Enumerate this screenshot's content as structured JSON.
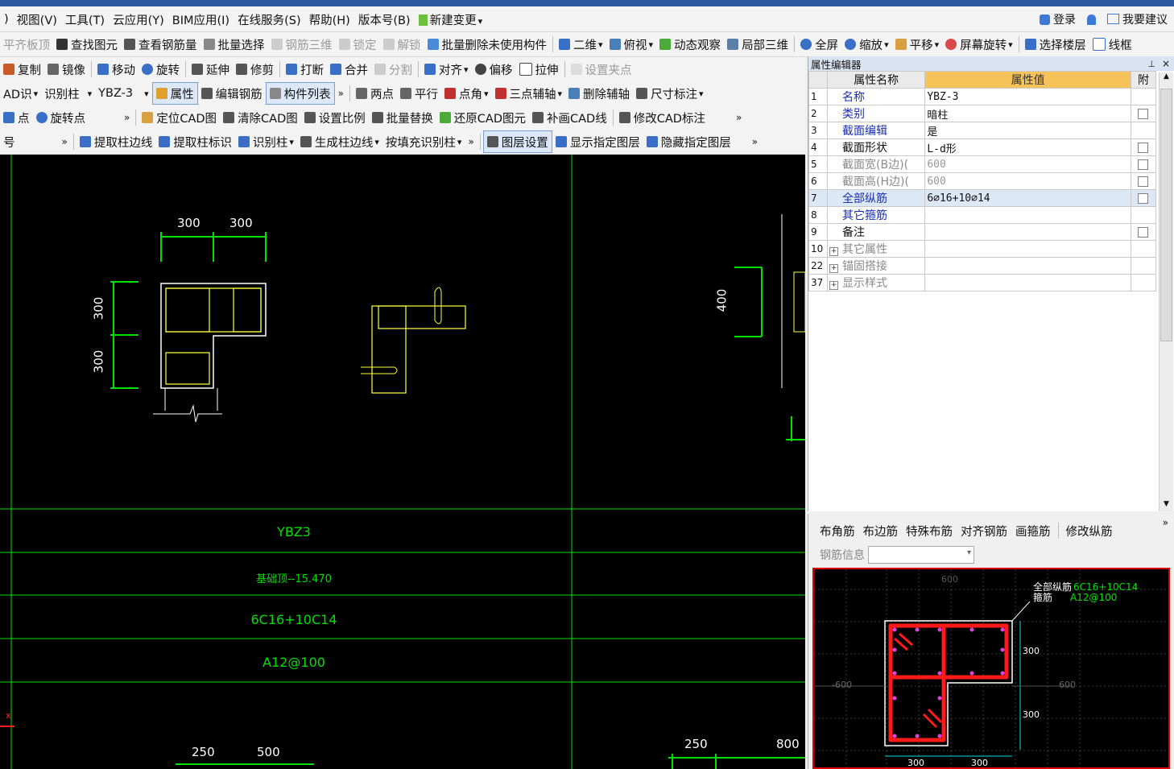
{
  "menubar": {
    "items": [
      "视图(V)",
      "工具(T)",
      "云应用(Y)",
      "BIM应用(I)",
      "在线服务(S)",
      "帮助(H)",
      "版本号(B)",
      "新建变更"
    ],
    "left_fragment": ")",
    "login": "登录",
    "suggest": "我要建议"
  },
  "toolbar1": [
    "平齐板顶",
    "查找图元",
    "查看钢筋量",
    "批量选择",
    "钢筋三维",
    "锁定",
    "解锁",
    "批量删除未使用构件",
    "二维",
    "俯视",
    "动态观察",
    "局部三维",
    "全屏",
    "缩放",
    "平移",
    "屏幕旋转",
    "选择楼层",
    "线框"
  ],
  "toolbar2": [
    "复制",
    "镜像",
    "移动",
    "旋转",
    "延伸",
    "修剪",
    "打断",
    "合并",
    "分割",
    "对齐",
    "偏移",
    "拉伸",
    "设置夹点"
  ],
  "toolbar3": {
    "cad_recog": "AD识",
    "recog_col": "识别柱",
    "component": "YBZ-3",
    "attr": "属性",
    "edit_rebar": "编辑钢筋",
    "comp_list": "构件列表",
    "two_point": "两点",
    "parallel": "平行",
    "point_angle": "点角",
    "three_point_axis": "三点辅轴",
    "delete_axis": "删除辅轴",
    "dimension": "尺寸标注"
  },
  "toolbar4": [
    "点",
    "旋转点",
    "定位CAD图",
    "清除CAD图",
    "设置比例",
    "批量替换",
    "还原CAD图元",
    "补画CAD线",
    "修改CAD标注"
  ],
  "toolbar5": {
    "left_fragment": "号",
    "items": [
      "提取柱边线",
      "提取柱标识",
      "识别柱",
      "生成柱边线",
      "按填充识别柱",
      "图层设置",
      "显示指定图层",
      "隐藏指定图层"
    ]
  },
  "canvas": {
    "dims_top": [
      "300",
      "300"
    ],
    "dims_left": [
      "300",
      "300"
    ],
    "dim_right": "400",
    "table": [
      "YBZ3",
      "基础顶--15.470",
      "6C16+10C14",
      "A12@100"
    ],
    "dims_bottom_left": [
      "250",
      "500"
    ],
    "dims_bottom_right": [
      "250",
      "800"
    ]
  },
  "property_editor": {
    "title": "属性编辑器",
    "col_name": "属性名称",
    "col_value": "属性值",
    "col_extra": "附",
    "rows": [
      {
        "no": "1",
        "name": "名称",
        "value": "YBZ-3"
      },
      {
        "no": "2",
        "name": "类别",
        "value": "暗柱"
      },
      {
        "no": "3",
        "name": "截面编辑",
        "value": "是"
      },
      {
        "no": "4",
        "name": "截面形状",
        "value": "L-d形"
      },
      {
        "no": "5",
        "name": "截面宽(B边)(",
        "value": "600"
      },
      {
        "no": "6",
        "name": "截面高(H边)(",
        "value": "600"
      },
      {
        "no": "7",
        "name": "全部纵筋",
        "value": "6⌀16+10⌀14"
      },
      {
        "no": "8",
        "name": "其它箍筋",
        "value": ""
      },
      {
        "no": "9",
        "name": "备注",
        "value": ""
      },
      {
        "no": "10",
        "name": "其它属性",
        "value": ""
      },
      {
        "no": "22",
        "name": "锚固搭接",
        "value": ""
      },
      {
        "no": "37",
        "name": "显示样式",
        "value": ""
      }
    ]
  },
  "rebar_panel": {
    "tools": [
      "布角筋",
      "布边筋",
      "特殊布筋",
      "对齐钢筋",
      "画箍筋",
      "修改纵筋"
    ],
    "info_label": "钢筋信息",
    "legend_long": "全部纵筋",
    "legend_long_val": "6C16+10C14",
    "legend_stirrup": "箍筋",
    "legend_stirrup_val": "A12@100",
    "dim_top": "600",
    "dim_left": "-600",
    "dim_right": "600",
    "dims_side": [
      "300",
      "300"
    ],
    "dims_bottom": [
      "300",
      "300"
    ]
  },
  "colors": {
    "cad_green": "#00e000",
    "cad_yellow": "#ffff40",
    "rebar_red": "#ff1a1a",
    "header_orange": "#f6c25a"
  }
}
